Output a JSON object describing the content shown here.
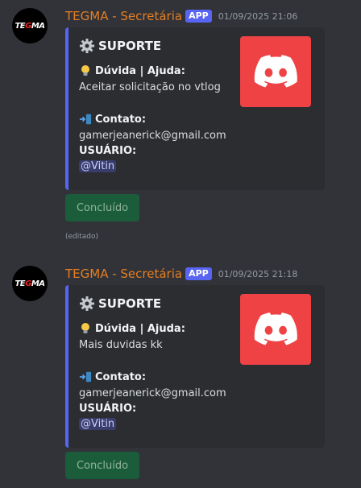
{
  "messages": [
    {
      "author": "TEGMA - Secretária",
      "badge": "APP",
      "timestamp": "01/09/2025 21:06",
      "avatar_text": "TEGMA",
      "embed": {
        "title": "SUPORTE",
        "icon": "gear-icon",
        "doubt_label": "Dúvida | Ajuda:",
        "doubt_value": "Aceitar solicitação no vtlog",
        "contact_label": "Contato:",
        "contact_value": "gamerjeanerick@gmail.com",
        "user_label": "USUÁRIO:",
        "user_value": "@Vitin",
        "thumbnail": "discord-logo-icon"
      },
      "button_label": "Concluído",
      "edited": "(editado)"
    },
    {
      "author": "TEGMA - Secretária",
      "badge": "APP",
      "timestamp": "01/09/2025 21:18",
      "avatar_text": "TEGMA",
      "embed": {
        "title": "SUPORTE",
        "icon": "gear-icon",
        "doubt_label": "Dúvida | Ajuda:",
        "doubt_value": "Mais duvidas kk",
        "contact_label": "Contato:",
        "contact_value": "gamerjeanerick@gmail.com",
        "user_label": "USUÁRIO:",
        "user_value": "@Vitin",
        "thumbnail": "discord-logo-icon"
      },
      "button_label": "Concluído"
    }
  ],
  "colors": {
    "background": "#313338",
    "embed_bg": "#2b2d31",
    "embed_border": "#5865f2",
    "username": "#e67e22",
    "badge": "#5865f2",
    "button": "#1b5c3a",
    "thumbnail": "#ee4245"
  }
}
